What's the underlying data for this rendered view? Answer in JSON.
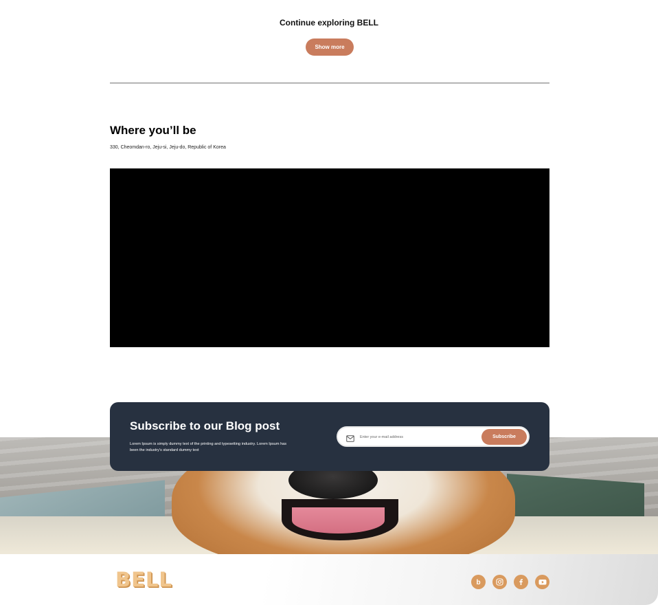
{
  "explore": {
    "title": "Continue exploring BELL",
    "show_more_label": "Show more"
  },
  "location": {
    "title": "Where you’ll be",
    "address": "330, Cheomdan-ro, Jeju-si, Jeju-do, Republic of Korea"
  },
  "subscribe": {
    "title": "Subscribe to our Blog post",
    "description": "Lorem Ipsum is simply dummy text of the printing and typesetting industry. Lorem Ipsum has been the industry's standard dummy text",
    "email_placeholder": "Enter your e-mail address",
    "button_label": "Subscribe"
  },
  "footer": {
    "logo_text": "BELL",
    "social_icons": [
      "blog-icon",
      "instagram-icon",
      "facebook-icon",
      "youtube-icon"
    ]
  },
  "colors": {
    "accent": "#c97c5d",
    "card_bg": "#273140",
    "social_bg": "#d99a5e",
    "logo": "#f0c58d"
  }
}
